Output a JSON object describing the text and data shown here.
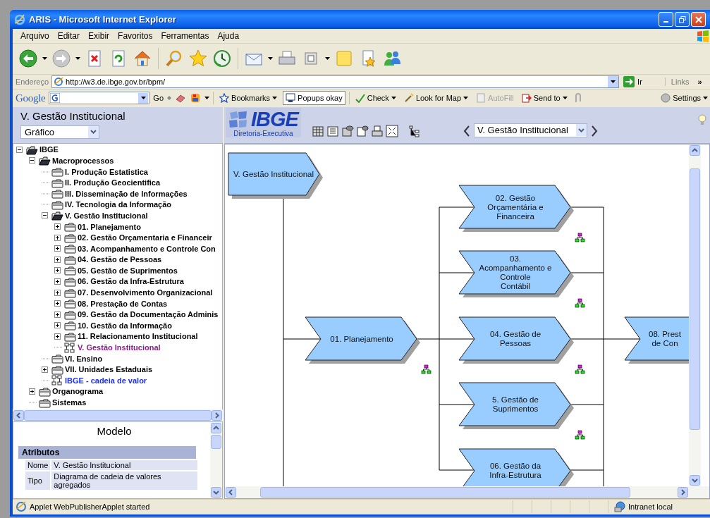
{
  "window": {
    "title": "ARIS - Microsoft Internet Explorer"
  },
  "menu": [
    "Arquivo",
    "Editar",
    "Exibir",
    "Favoritos",
    "Ferramentas",
    "Ajuda"
  ],
  "address_bar": {
    "label": "Endereço",
    "url": "http://w3.de.ibge.gov.br/bpm/",
    "go_button": "Ir",
    "links": "Links",
    "more": "»"
  },
  "google_toolbar": {
    "logo": "Google",
    "go": "Go",
    "items": [
      {
        "label": "Bookmarks",
        "dropdown": true,
        "disabled": false,
        "pressed": false
      },
      {
        "label": "Popups okay",
        "dropdown": false,
        "disabled": false,
        "pressed": true
      },
      {
        "label": "Check",
        "dropdown": true,
        "disabled": false,
        "pressed": false
      },
      {
        "label": "Look for Map",
        "dropdown": true,
        "disabled": false,
        "pressed": false
      },
      {
        "label": "AutoFill",
        "dropdown": false,
        "disabled": true,
        "pressed": false
      },
      {
        "label": "Send to",
        "dropdown": true,
        "disabled": false,
        "pressed": false
      },
      {
        "label": "Settings",
        "dropdown": true,
        "disabled": false,
        "pressed": false
      }
    ]
  },
  "sidebar": {
    "title": "V. Gestão Institucional",
    "view_select": "Gráfico",
    "tree": [
      {
        "label": "IBGE",
        "kind": "folder",
        "expandable": true,
        "expanded": true,
        "selected": false,
        "children": [
          {
            "label": "Macroprocessos",
            "kind": "folder",
            "expandable": true,
            "expanded": true,
            "selected": false,
            "children": [
              {
                "label": "I. Produção Estatistica",
                "kind": "folder",
                "expandable": false,
                "expanded": false,
                "selected": false
              },
              {
                "label": "II. Produção Geocientifica",
                "kind": "folder",
                "expandable": false,
                "expanded": false,
                "selected": false
              },
              {
                "label": "III. Disseminação de Informações",
                "kind": "folder",
                "expandable": false,
                "expanded": false,
                "selected": false
              },
              {
                "label": "IV. Tecnologia da Informação",
                "kind": "folder",
                "expandable": false,
                "expanded": false,
                "selected": false
              },
              {
                "label": "V. Gestão Institucional",
                "kind": "folder",
                "expandable": true,
                "expanded": true,
                "selected": false,
                "children": [
                  {
                    "label": "01. Planejamento",
                    "kind": "folder",
                    "expandable": true,
                    "expanded": false,
                    "selected": false
                  },
                  {
                    "label": "02. Gestão Orçamentaria e Financeir",
                    "kind": "folder",
                    "expandable": true,
                    "expanded": false,
                    "selected": false
                  },
                  {
                    "label": "03. Acompanhamento e Controle Con",
                    "kind": "folder",
                    "expandable": true,
                    "expanded": false,
                    "selected": false
                  },
                  {
                    "label": "04. Gestão de Pessoas",
                    "kind": "folder",
                    "expandable": true,
                    "expanded": false,
                    "selected": false
                  },
                  {
                    "label": "05. Gestão de Suprimentos",
                    "kind": "folder",
                    "expandable": true,
                    "expanded": false,
                    "selected": false
                  },
                  {
                    "label": "06. Gestão da Infra-Estrutura",
                    "kind": "folder",
                    "expandable": true,
                    "expanded": false,
                    "selected": false
                  },
                  {
                    "label": "07. Desenvolvimento Organizacional",
                    "kind": "folder",
                    "expandable": true,
                    "expanded": false,
                    "selected": false
                  },
                  {
                    "label": "08. Prestação de Contas",
                    "kind": "folder",
                    "expandable": true,
                    "expanded": false,
                    "selected": false
                  },
                  {
                    "label": "09. Gestão da Documentação Adminis",
                    "kind": "folder",
                    "expandable": true,
                    "expanded": false,
                    "selected": false
                  },
                  {
                    "label": "10. Gestão da Informação",
                    "kind": "folder",
                    "expandable": true,
                    "expanded": false,
                    "selected": false
                  },
                  {
                    "label": "11. Relacionamento Institucional",
                    "kind": "folder",
                    "expandable": true,
                    "expanded": false,
                    "selected": false
                  },
                  {
                    "label": "V. Gestão Institucional",
                    "kind": "model",
                    "expandable": false,
                    "selected": true
                  }
                ]
              },
              {
                "label": "VI. Ensino",
                "kind": "folder",
                "expandable": false,
                "expanded": false,
                "selected": false
              },
              {
                "label": "VII. Unidades Estaduais",
                "kind": "folder",
                "expandable": true,
                "expanded": false,
                "selected": false
              },
              {
                "label": "IBGE - cadeia de valor",
                "kind": "model",
                "expandable": false,
                "selected": false
              }
            ]
          },
          {
            "label": "Organograma",
            "kind": "folder",
            "expandable": true,
            "expanded": false,
            "selected": false
          },
          {
            "label": "Sistemas",
            "kind": "folder",
            "expandable": false,
            "expanded": false,
            "selected": false
          }
        ]
      }
    ],
    "detail": {
      "title": "Modelo",
      "section": "Atributos",
      "rows": [
        {
          "name": "Nome",
          "value": "V. Gestão Institucional"
        },
        {
          "name": "Tipo",
          "value": "Diagrama de cadeia de valores agregados"
        }
      ]
    }
  },
  "viewer": {
    "logo": "IBGE",
    "logo_subtitle": "Diretoria-Executiva",
    "model_select": "V. Gestão Institucional",
    "diagram": {
      "nodes": [
        {
          "kind": "main",
          "label": "V. Gestão Institucional",
          "has_assignment": false
        },
        {
          "kind": "process",
          "label": "02. Gestão\nOrçamentária e\nFinanceira",
          "has_assignment": true
        },
        {
          "kind": "process",
          "label": "03.\nAcompanhamento e\nControle\nContábil",
          "has_assignment": true
        },
        {
          "kind": "process",
          "label": "01. Planejamento",
          "has_assignment": true
        },
        {
          "kind": "process",
          "label": "04. Gestão de\nPessoas",
          "has_assignment": true
        },
        {
          "kind": "process",
          "label": "08. Prest\nde Con",
          "has_assignment": false
        },
        {
          "kind": "process",
          "label": "5. Gestão de\nSuprimentos",
          "has_assignment": true
        },
        {
          "kind": "process",
          "label": "06. Gestão da\nInfra-Estrutura",
          "has_assignment": false
        }
      ]
    }
  },
  "status_bar": {
    "text": "Applet WebPublisherApplet started",
    "zone": "Intranet local"
  }
}
